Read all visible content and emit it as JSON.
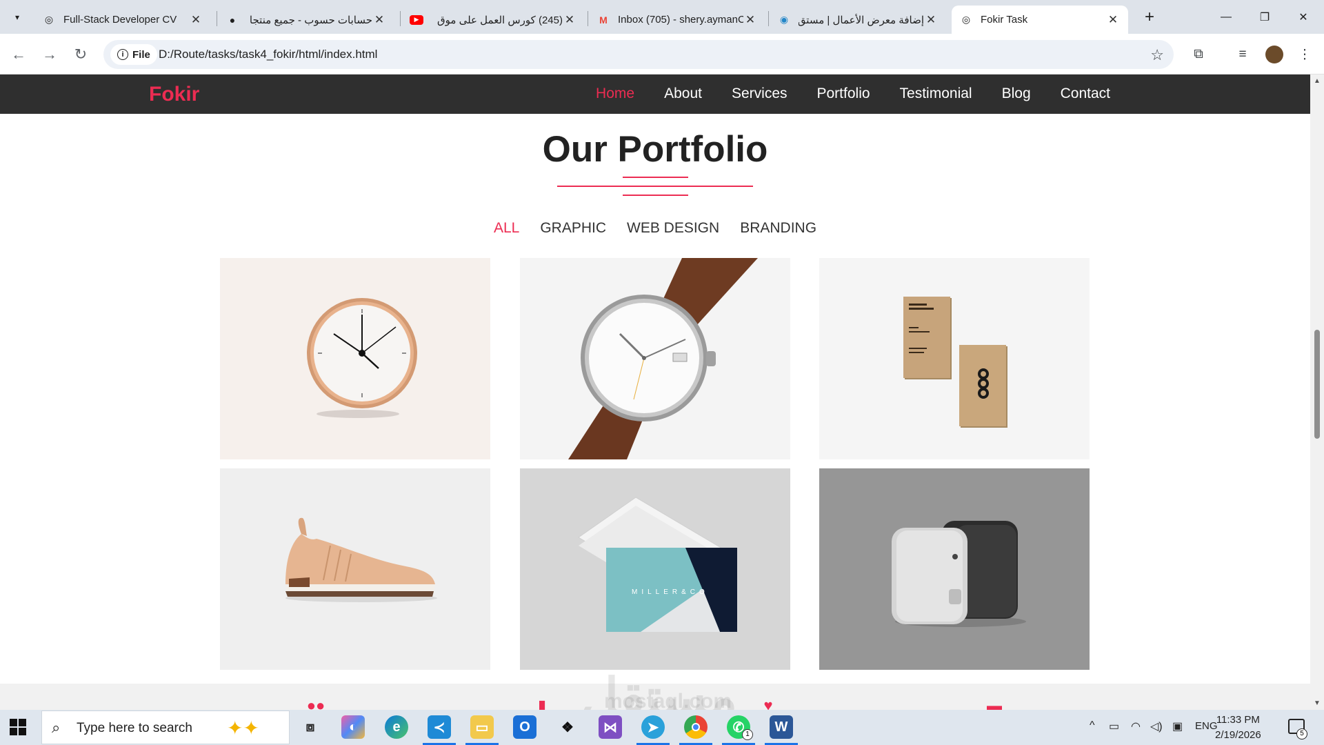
{
  "browser": {
    "tabs": [
      {
        "title": "Full-Stack Developer CV",
        "icon": "globe-icon"
      },
      {
        "title": "حسابات حسوب - جميع منتجا",
        "icon": "hsoub-icon"
      },
      {
        "title": "(245) كورس العمل على موق",
        "icon": "youtube-icon"
      },
      {
        "title": "Inbox (705) - shery.aymanC",
        "icon": "gmail-icon"
      },
      {
        "title": "إضافة معرض الأعمال | مستق",
        "icon": "mostaql-icon"
      },
      {
        "title": "Fokir Task",
        "icon": "globe-icon",
        "active": true
      }
    ],
    "address": {
      "scheme_label": "File",
      "url": "D:/Route/tasks/task4_fokir/html/index.html"
    }
  },
  "page": {
    "brand": "Fokir",
    "nav": [
      "Home",
      "About",
      "Services",
      "Portfolio",
      "Testimonial",
      "Blog",
      "Contact"
    ],
    "active_nav": "Home",
    "section_title": "Our Portfolio",
    "filters": [
      "ALL",
      "GRAPHIC",
      "WEB DESIGN",
      "BRANDING"
    ],
    "active_filter": "ALL",
    "portfolio_items": [
      {
        "subject": "wall-clock",
        "bg": "#f6f0ec"
      },
      {
        "subject": "wrist-watch",
        "bg": "#f4f4f4"
      },
      {
        "subject": "business-cards-kraft",
        "bg": "#f5f5f5"
      },
      {
        "subject": "sneaker",
        "bg": "#efefef"
      },
      {
        "subject": "business-cards-millerco",
        "bg": "#d6d6d6",
        "card_text": "MILLER&CO"
      },
      {
        "subject": "device-gadgets",
        "bg": "#969696"
      }
    ],
    "accent_color": "#ec2c52",
    "navbar_bg": "#2f2f2f"
  },
  "watermark": {
    "text": "مستقل",
    "latin": "mostaql.com"
  },
  "taskbar": {
    "search_placeholder": "Type here to search",
    "language": "ENG",
    "time": "11:33 PM",
    "date": "2/19/2026",
    "notification_count": "5",
    "whatsapp_badge": "1"
  }
}
